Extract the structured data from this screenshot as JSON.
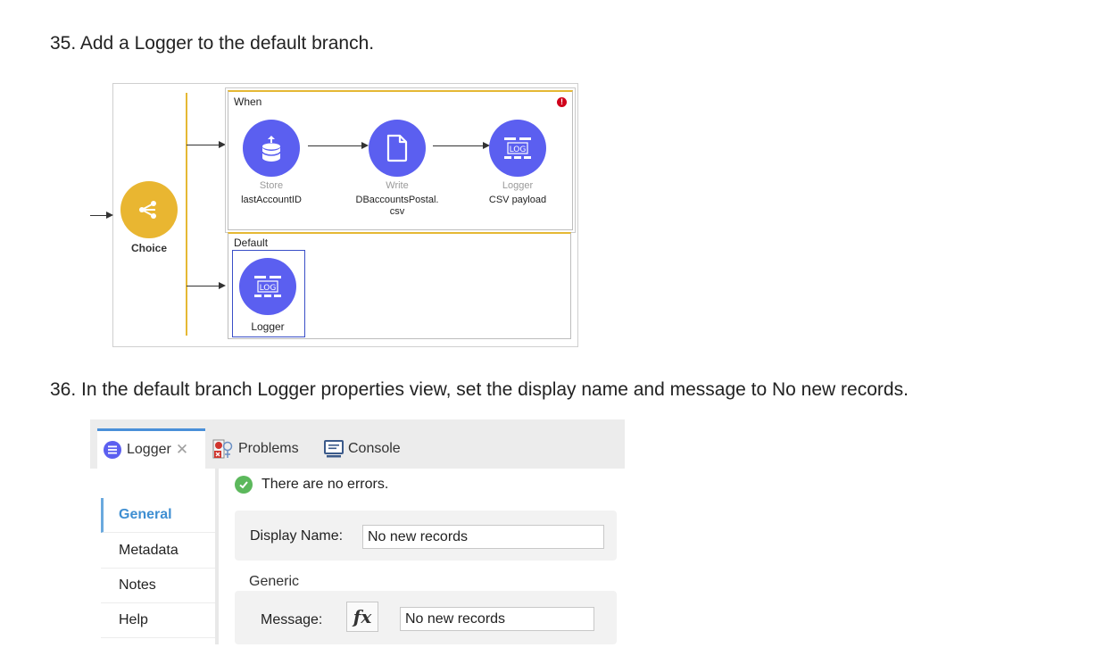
{
  "steps": {
    "step35": "35. Add a Logger to the default branch.",
    "step36": "36. In the default branch Logger properties view, set the display name and message to No new records."
  },
  "flow": {
    "router": {
      "label": "Choice",
      "icon": "choice-router-icon",
      "color": "#e9b631"
    },
    "branches": {
      "when": {
        "title": "When",
        "error_icon": "!",
        "nodes": [
          {
            "sub": "Store",
            "name": "lastAccountID",
            "icon": "database-upload-icon"
          },
          {
            "sub": "Write",
            "name": "DBaccountsPostal.\ncsv",
            "icon": "file-icon"
          },
          {
            "sub": "Logger",
            "name": "CSV payload",
            "icon": "log-icon"
          }
        ]
      },
      "default": {
        "title": "Default",
        "nodes": [
          {
            "name": "Logger",
            "icon": "log-icon"
          }
        ]
      }
    },
    "node_color": "#5b5ff0",
    "branch_accent": "#e5b834"
  },
  "panel": {
    "tabs": [
      {
        "label": "Logger",
        "icon": "logger-tab-icon",
        "active": true,
        "close": "✕"
      },
      {
        "label": "Problems",
        "icon": "problems-icon",
        "active": false
      },
      {
        "label": "Console",
        "icon": "console-icon",
        "active": false
      }
    ],
    "status_message": "There are no errors.",
    "sidebar": [
      {
        "label": "General",
        "active": true
      },
      {
        "label": "Metadata",
        "active": false
      },
      {
        "label": "Notes",
        "active": false
      },
      {
        "label": "Help",
        "active": false
      }
    ],
    "general": {
      "display_name_label": "Display Name:",
      "display_name_value": "No new records"
    },
    "generic": {
      "section_label": "Generic",
      "message_label": "Message:",
      "fx_label": "fx",
      "message_value": "No new records"
    }
  }
}
